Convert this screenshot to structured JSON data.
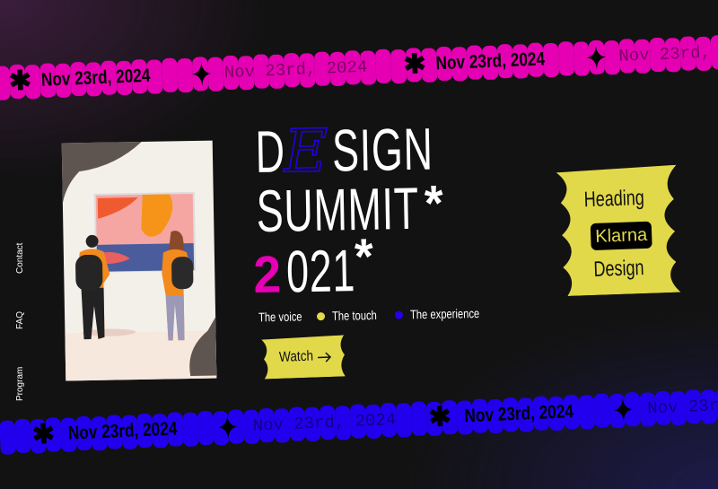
{
  "ribbons": {
    "top": {
      "color": "#e500b4",
      "bold_date": "Nov 23rd, 2024",
      "mono_date": "Nov 23rd, 2024"
    },
    "bottom": {
      "color": "#2200ee",
      "bold_date": "Nov 23rd, 2024",
      "mono_date": "Nov 23rd, 2024"
    }
  },
  "nav": {
    "items": [
      "Contact",
      "FAQ",
      "Program"
    ]
  },
  "hero": {
    "title_line1_start": "D",
    "title_line1_script": "E",
    "title_line1_end": "SIGN",
    "title_line2": "SUMMIT",
    "title_line2_mark": "*",
    "title_line3_accent": "2",
    "title_line3_rest": "021",
    "title_line3_mark": "*",
    "tags": [
      "The voice",
      "The touch",
      "The experience"
    ],
    "tag_dot_colors": [
      "#e2d94a",
      "#2200ee"
    ],
    "watch_label": "Watch",
    "watch_icon": "arrow-right-icon"
  },
  "badge": {
    "top": "Heading",
    "middle": "Klarna",
    "bottom": "Design",
    "color": "#e2d94a"
  },
  "colors": {
    "background": "#121212",
    "accent_pink": "#e500b4",
    "accent_blue": "#2200ee",
    "accent_yellow": "#e2d94a"
  }
}
